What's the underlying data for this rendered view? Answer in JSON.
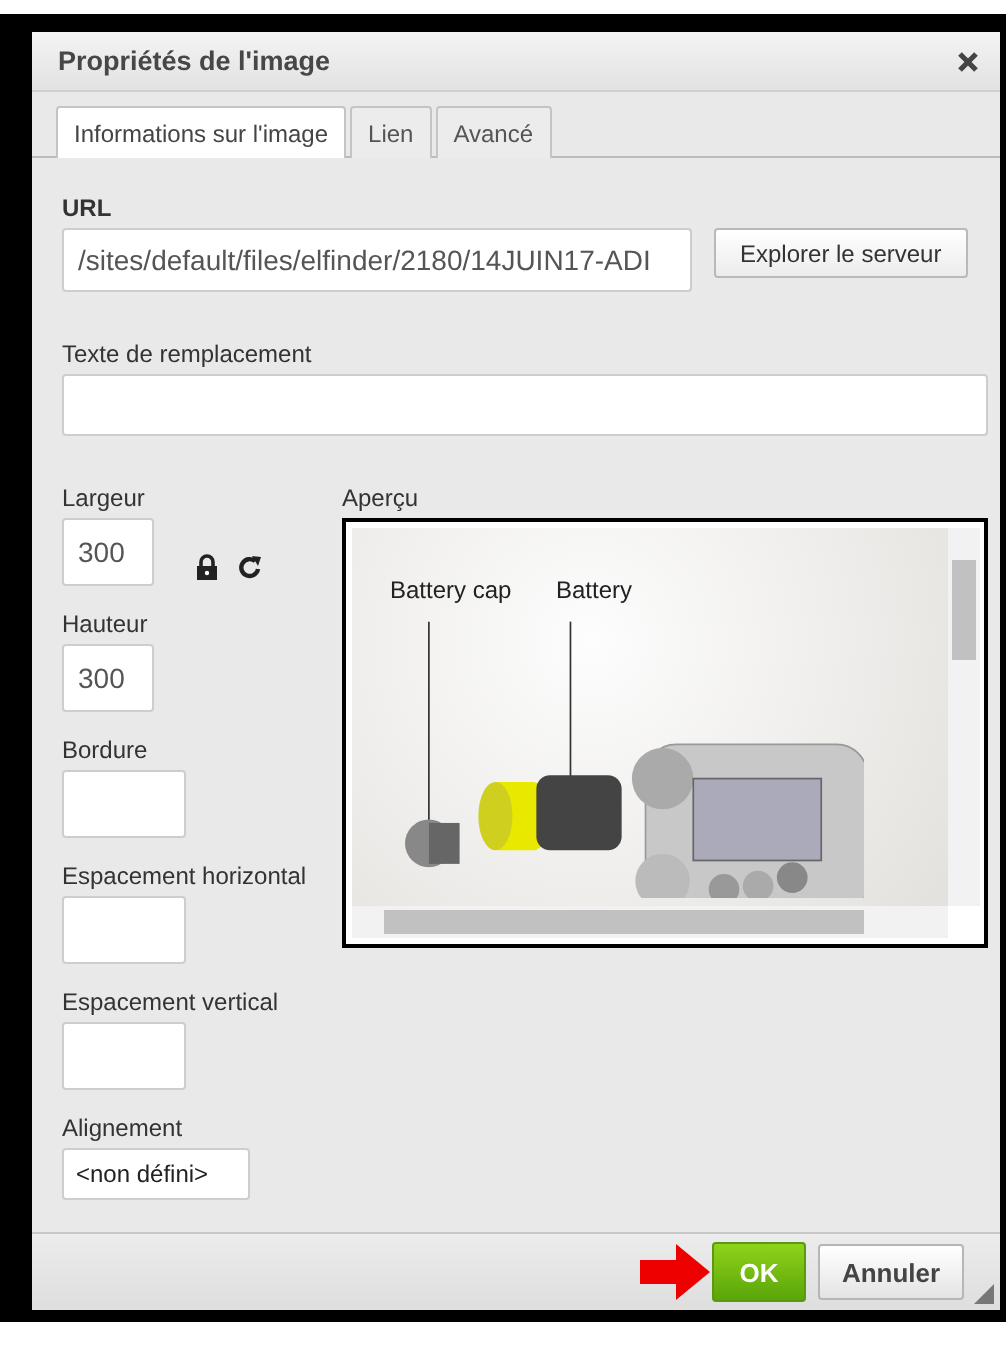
{
  "dialog": {
    "title": "Propriétés de l'image"
  },
  "tabs": [
    {
      "label": "Informations sur l'image",
      "selected": true
    },
    {
      "label": "Lien",
      "selected": false
    },
    {
      "label": "Avancé",
      "selected": false
    }
  ],
  "url": {
    "label": "URL",
    "value": "/sites/default/files/elfinder/2180/14JUIN17-ADI",
    "browse_button": "Explorer le serveur"
  },
  "alt_text": {
    "label": "Texte de remplacement"
  },
  "width": {
    "label": "Largeur",
    "value": "300"
  },
  "height": {
    "label": "Hauteur",
    "value": "300"
  },
  "border": {
    "label": "Bordure"
  },
  "hspace": {
    "label": "Espacement horizontal"
  },
  "vspace": {
    "label": "Espacement vertical"
  },
  "alignment": {
    "label": "Alignement",
    "value": "<non défini>"
  },
  "preview": {
    "label": "Aperçu",
    "callouts": [
      "Battery cap",
      "Battery"
    ]
  },
  "buttons": {
    "ok": "OK",
    "cancel": "Annuler"
  }
}
